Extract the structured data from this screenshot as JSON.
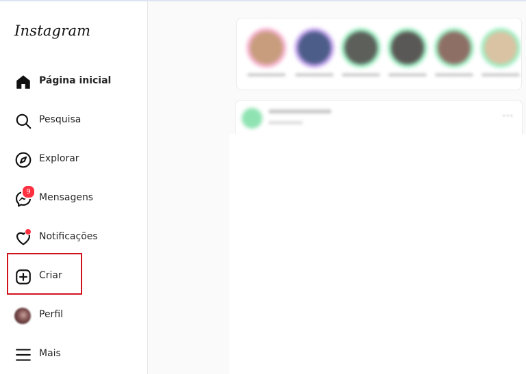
{
  "brand": {
    "logo_text": "Instagram"
  },
  "sidebar": {
    "items": [
      {
        "id": "home",
        "label": "Página inicial",
        "icon": "home-icon",
        "active": true
      },
      {
        "id": "search",
        "label": "Pesquisa",
        "icon": "search-icon"
      },
      {
        "id": "explore",
        "label": "Explorar",
        "icon": "compass-icon"
      },
      {
        "id": "messages",
        "label": "Mensagens",
        "icon": "messenger-icon",
        "badge": "9"
      },
      {
        "id": "notifications",
        "label": "Notificações",
        "icon": "heart-icon",
        "dot": true
      },
      {
        "id": "create",
        "label": "Criar",
        "icon": "plus-square-icon",
        "highlighted": true
      },
      {
        "id": "profile",
        "label": "Perfil",
        "icon": "avatar"
      },
      {
        "id": "more",
        "label": "Mais",
        "icon": "hamburger-menu-icon"
      }
    ]
  },
  "colors": {
    "badge": "#ff3040",
    "highlight": "#d0121b",
    "text": "#262626"
  },
  "stories": {
    "ring_colors": [
      "#f7b3d1",
      "#c7a6f0",
      "#9ff0c4",
      "#9ff0c4",
      "#9ff0c4",
      "#9ff0c4"
    ],
    "pic_colors": [
      "#c79d7e",
      "#4d5d8a",
      "#5c5f5a",
      "#5a5856",
      "#8e6f66",
      "#d9c3a3"
    ]
  },
  "post": {
    "more_label": "···"
  }
}
